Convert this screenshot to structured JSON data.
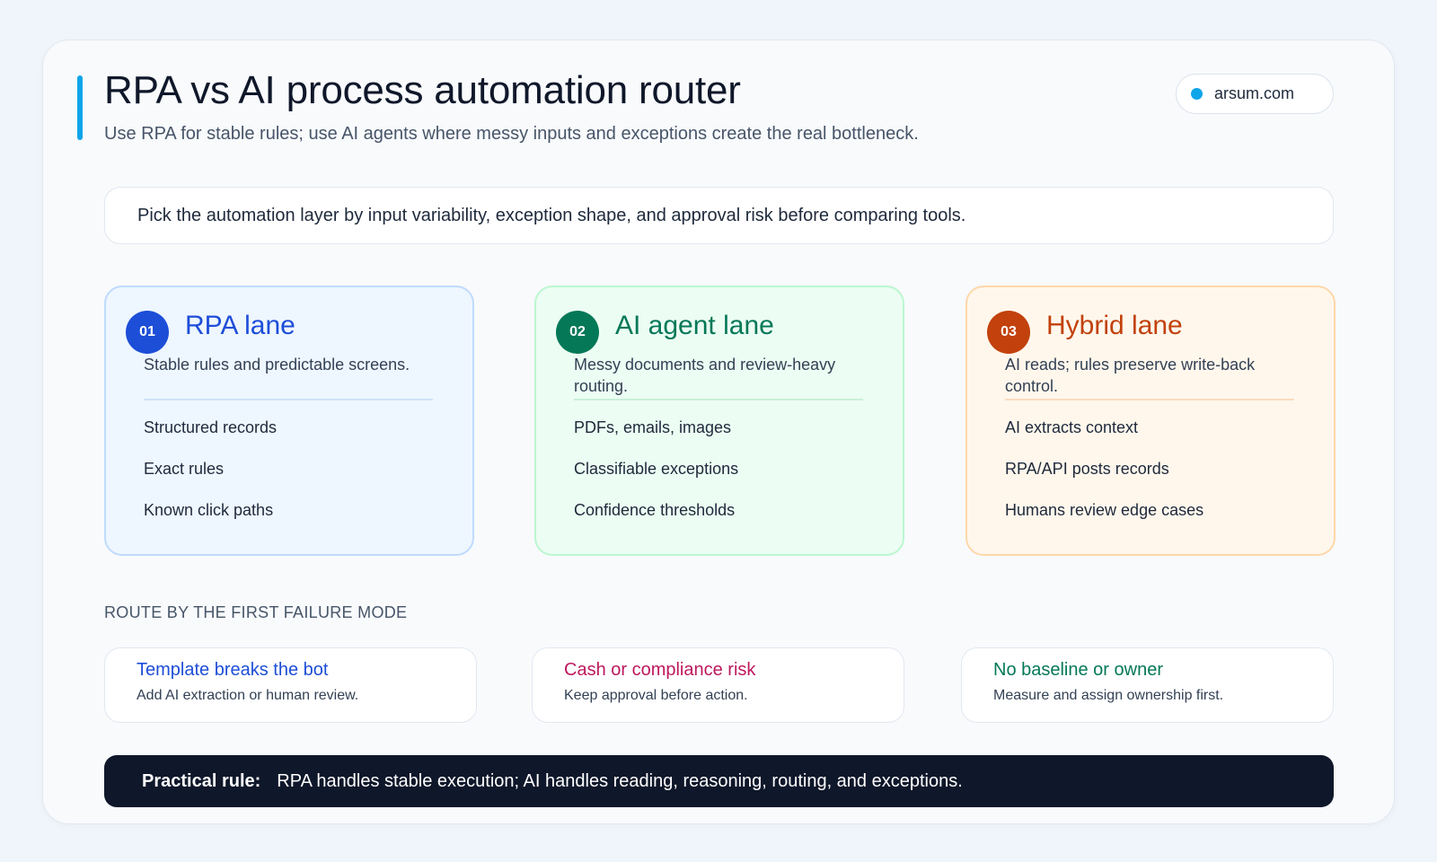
{
  "header": {
    "title": "RPA vs AI process automation router",
    "subtitle": "Use RPA for stable rules; use AI agents where messy inputs and exceptions create the real bottleneck.",
    "brand": "arsum.com"
  },
  "intro": "Pick the automation layer by input variability, exception shape, and approval risk before comparing tools.",
  "lanes": [
    {
      "number": "01",
      "title": "RPA lane",
      "description": "Stable rules and predictable screens.",
      "items": [
        "Structured records",
        "Exact rules",
        "Known click paths"
      ]
    },
    {
      "number": "02",
      "title": "AI agent lane",
      "description": "Messy documents and review-heavy routing.",
      "items": [
        "PDFs, emails, images",
        "Classifiable exceptions",
        "Confidence thresholds"
      ]
    },
    {
      "number": "03",
      "title": "Hybrid lane",
      "description": "AI reads; rules preserve write-back control.",
      "items": [
        "AI extracts context",
        "RPA/API posts records",
        "Humans review edge cases"
      ]
    }
  ],
  "failure_section": {
    "label": "ROUTE BY THE FIRST FAILURE MODE",
    "cards": [
      {
        "title": "Template breaks the bot",
        "description": "Add AI extraction or human review."
      },
      {
        "title": "Cash or compliance risk",
        "description": "Keep approval before action."
      },
      {
        "title": "No baseline or owner",
        "description": "Measure and assign ownership first."
      }
    ]
  },
  "rule": {
    "label": "Practical rule:",
    "text": "RPA handles stable execution; AI handles reading, reasoning, routing, and exceptions."
  },
  "colors": {
    "accent": "#0ea5e9",
    "rpa": "#1d4ed8",
    "ai": "#047857",
    "hybrid": "#c2410c",
    "risk": "#be185d",
    "dark": "#0f172a"
  }
}
